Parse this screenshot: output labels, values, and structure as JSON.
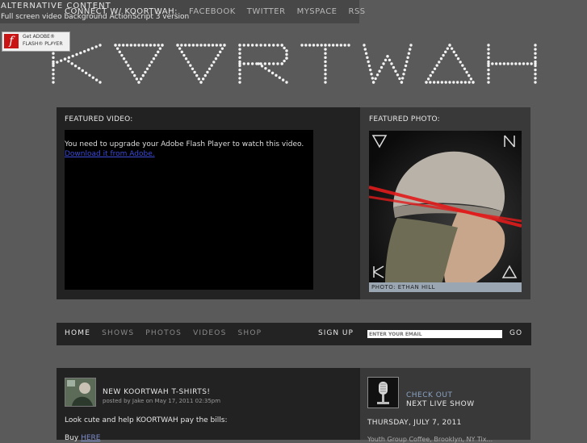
{
  "header": {
    "alt_content": "ALTERNATIVE CONTENT",
    "alt_sub": "Full screen video background ActionScript 3 version",
    "topnav": [
      "CONNECT W/ KOORTWAH:",
      "FACEBOOK",
      "TWITTER",
      "MYSPACE",
      "RSS"
    ]
  },
  "flash_badge": {
    "line1": "Get ADOBE®",
    "line2": "FLASH® PLAYER",
    "icon": "flash-player-icon"
  },
  "logo": {
    "text": "KOORTWAH"
  },
  "featured_video": {
    "title": "FEATURED VIDEO:",
    "message": "You need to upgrade your Adobe Flash Player to watch this video.",
    "link": "Download it from Adobe."
  },
  "featured_photo": {
    "title": "FEATURED PHOTO:",
    "caption": "PHOTO: ETHAN HILL"
  },
  "nav": {
    "items": [
      "HOME",
      "SHOWS",
      "PHOTOS",
      "VIDEOS",
      "SHOP"
    ],
    "signup_label": "SIGN UP",
    "email_placeholder": "ENTER YOUR EMAIL",
    "go_label": "GO"
  },
  "news": {
    "title": "NEW KOORTWAH T-SHIRTS!",
    "meta": "posted by Jake on May 17, 2011 02:35pm",
    "body": "Look cute and help KOORTWAH pay the bills:",
    "buy_prefix": "Buy ",
    "buy_link": "HERE"
  },
  "live_show": {
    "line1": "CHECK OUT",
    "line2": "NEXT LIVE SHOW",
    "date": "THURSDAY, JULY 7, 2011",
    "venue": "Youth Group Coffee, Brooklyn, NY Tix..."
  },
  "colors": {
    "accent_red": "#e11b1b",
    "link_blue": "#3c4bd8",
    "caption_bg": "#9aa7b3"
  }
}
